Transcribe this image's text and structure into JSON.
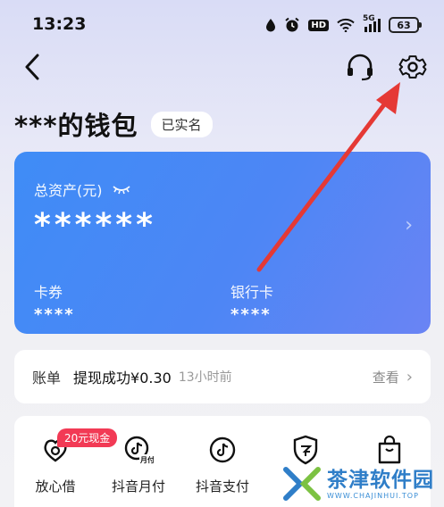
{
  "status_bar": {
    "time": "13:23",
    "network": "5G",
    "hd": "HD",
    "battery": "63"
  },
  "nav": {
    "back_icon": "chevron-left-icon",
    "support_icon": "headset-icon",
    "settings_icon": "gear-icon"
  },
  "header": {
    "title": "***的钱包",
    "verified": "已实名"
  },
  "asset_card": {
    "label": "总资产(元)",
    "amount": "******",
    "coupons_label": "卡券",
    "coupons_value": "****",
    "bank_label": "银行卡",
    "bank_value": "****"
  },
  "bill": {
    "label": "账单",
    "desc": "提现成功¥0.30",
    "time": "13小时前",
    "view": "查看"
  },
  "services": {
    "promo": "20元现金",
    "items": [
      {
        "label": "放心借",
        "icon": "loan-icon"
      },
      {
        "label": "抖音月付",
        "icon": "monthly-pay-icon"
      },
      {
        "label": "抖音支付",
        "icon": "douyin-pay-icon"
      },
      {
        "label": "",
        "icon": "shield-icon"
      },
      {
        "label": "",
        "icon": "shopping-bag-icon"
      }
    ]
  },
  "colors": {
    "card_start": "#3f8cf6",
    "card_end": "#6a84f4",
    "promo": "#f23a55",
    "arrow": "#e53935"
  },
  "watermark": {
    "cn": "茶津软件园",
    "en": "WWW.CHAJINHUI.TOP"
  }
}
